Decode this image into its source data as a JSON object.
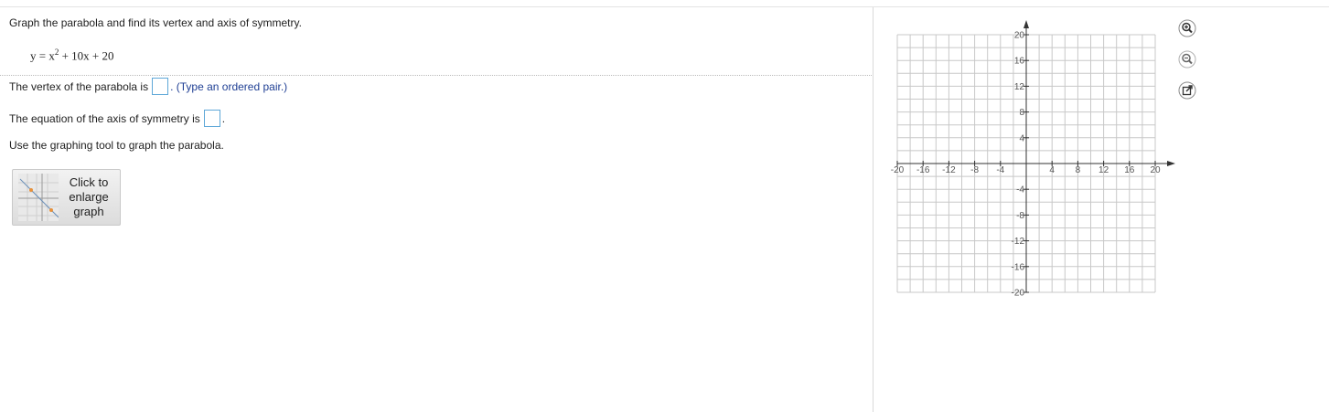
{
  "question": {
    "prompt": "Graph the parabola and find its vertex and axis of symmetry.",
    "equation_lhs": "y = x",
    "equation_exp": "2",
    "equation_rhs": " + 10x + 20",
    "vertex_label": "The vertex of the parabola is",
    "vertex_value": "",
    "vertex_hint": ". (Type an ordered pair.)",
    "axis_label": "The equation of the axis of symmetry is",
    "axis_value": "",
    "axis_end": ".",
    "instruction": "Use the graphing tool to graph the parabola."
  },
  "enlarge_button": {
    "line1": "Click to",
    "line2": "enlarge",
    "line3": "graph"
  },
  "graph": {
    "x_range": [
      -20,
      20
    ],
    "y_range": [
      -20,
      20
    ],
    "grid_step": 2,
    "x_tick_labels": [
      "-20",
      "-16",
      "-12",
      "-8",
      "-4",
      "4",
      "8",
      "12",
      "16",
      "20"
    ],
    "y_tick_labels": [
      "20",
      "16",
      "12",
      "8",
      "4",
      "-4",
      "-8",
      "-12",
      "-16",
      "-20"
    ]
  },
  "tools": [
    {
      "name": "zoom-in-icon"
    },
    {
      "name": "zoom-out-icon"
    },
    {
      "name": "popout-icon"
    }
  ],
  "colors": {
    "input_border": "#5fa8d8",
    "hint_text": "#1f3f94",
    "grid": "#c8c8c8",
    "axis": "#333333"
  }
}
